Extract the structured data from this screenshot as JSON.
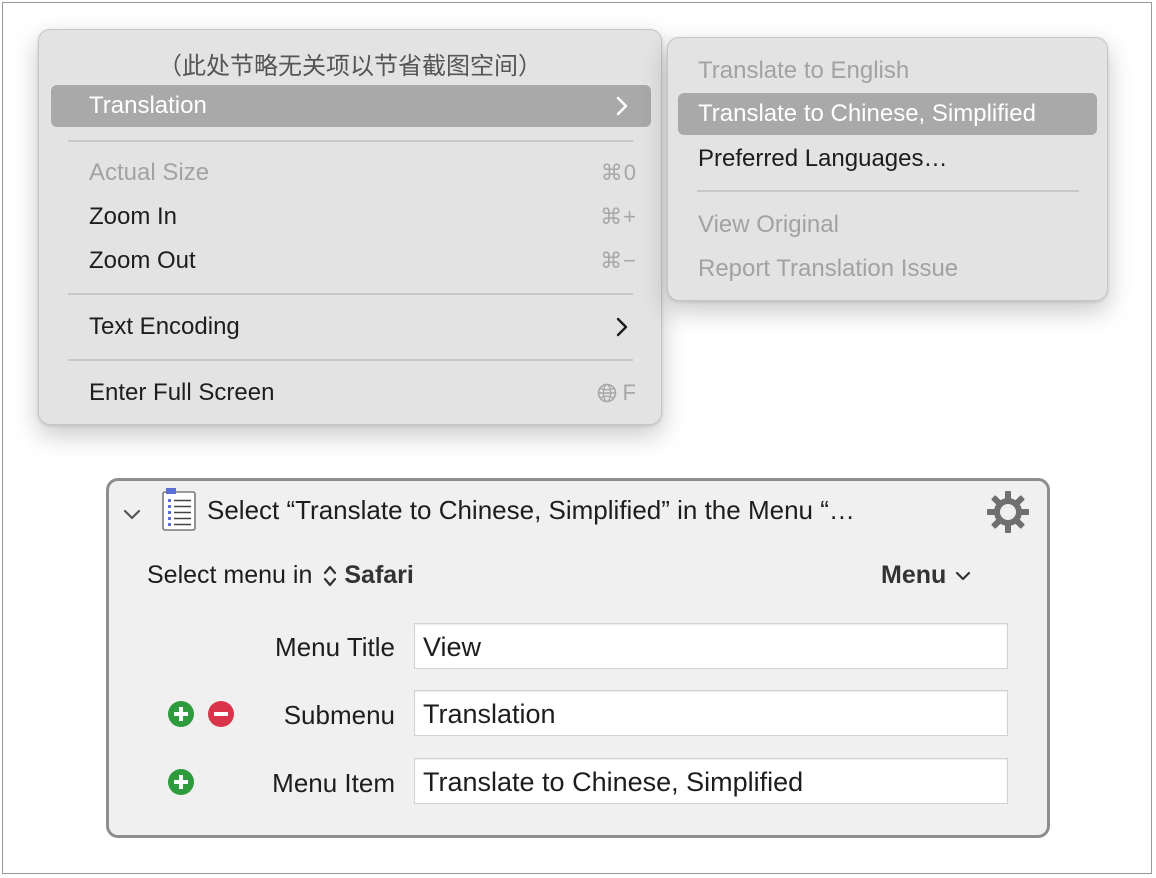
{
  "main_menu": {
    "header_note": "（此处节略无关项以节省截图空间）",
    "items": [
      {
        "label": "Translation",
        "state": "highlighted",
        "has_submenu": true
      },
      {
        "label": "Actual Size",
        "shortcut": "⌘0",
        "state": "disabled"
      },
      {
        "label": "Zoom In",
        "shortcut": "⌘+",
        "state": "enabled"
      },
      {
        "label": "Zoom Out",
        "shortcut": "⌘−",
        "state": "enabled"
      },
      {
        "label": "Text Encoding",
        "state": "enabled",
        "has_submenu": true
      },
      {
        "label": "Enter Full Screen",
        "shortcut": "F",
        "shortcut_icon": "globe-icon",
        "state": "enabled"
      }
    ]
  },
  "submenu": {
    "items": [
      {
        "label": "Translate to English",
        "state": "disabled"
      },
      {
        "label": "Translate to Chinese, Simplified",
        "state": "highlighted"
      },
      {
        "label": "Preferred Languages…",
        "state": "enabled"
      },
      {
        "label": "View Original",
        "state": "disabled"
      },
      {
        "label": "Report Translation Issue",
        "state": "disabled"
      }
    ]
  },
  "action": {
    "title": "Select “Translate to Chinese, Simplified” in the Menu “…",
    "select_menu_in_label": "Select menu in",
    "app_name": "Safari",
    "menu_dropdown_label": "Menu",
    "fields": [
      {
        "label": "Menu Title",
        "value": "View",
        "buttons": []
      },
      {
        "label": "Submenu",
        "value": "Translation",
        "buttons": [
          "add",
          "remove"
        ]
      },
      {
        "label": "Menu Item",
        "value": "Translate to Chinese, Simplified",
        "buttons": [
          "add"
        ]
      }
    ]
  },
  "colors": {
    "menu_bg": "#e3e3e3",
    "highlight": "#a9a9a9",
    "disabled_text": "#a2a2a2",
    "add_green": "#2e9b3c",
    "remove_red": "#d9344a"
  }
}
